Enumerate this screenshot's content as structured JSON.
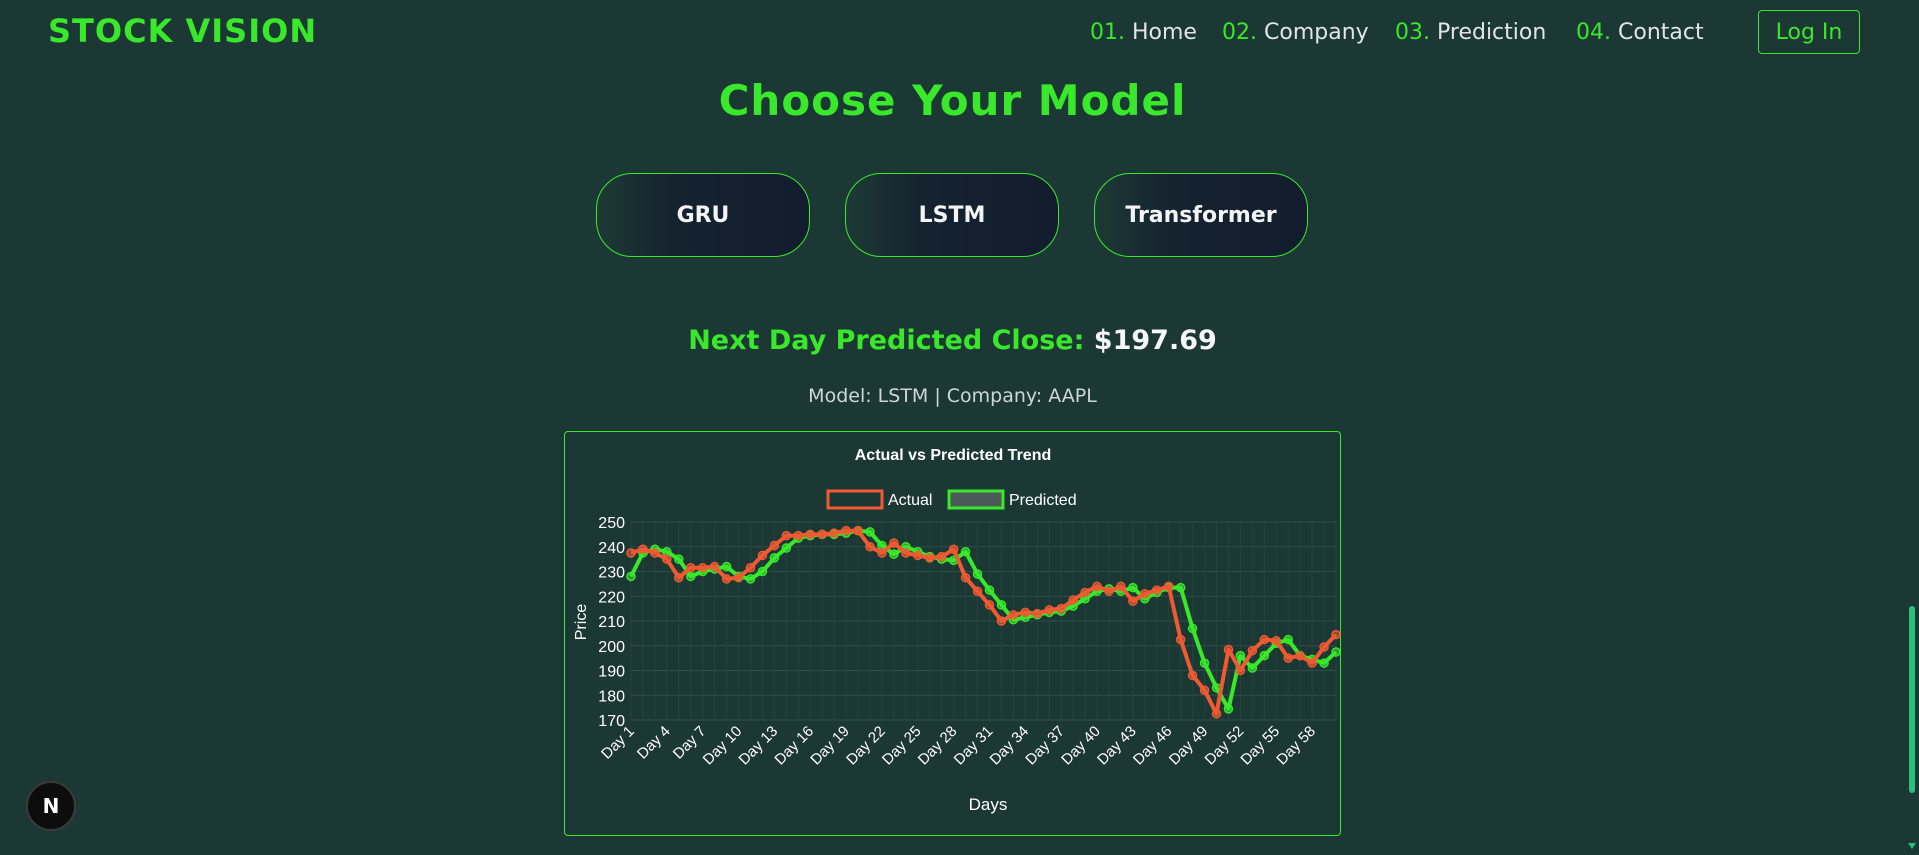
{
  "brand": "STOCK VISION",
  "nav": [
    {
      "num": "01.",
      "label": "Home"
    },
    {
      "num": "02.",
      "label": "Company"
    },
    {
      "num": "03.",
      "label": "Prediction"
    },
    {
      "num": "04.",
      "label": "Contact"
    }
  ],
  "login_label": "Log In",
  "heading": "Choose Your Model",
  "models": [
    "GRU",
    "LSTM",
    "Transformer"
  ],
  "prediction": {
    "label": "Next Day Predicted Close:",
    "value": "$197.69"
  },
  "meta": "Model: LSTM | Company: AAPL",
  "badge_letter": "N",
  "colors": {
    "accent": "#39e82a",
    "actual": "#ef5a32",
    "predicted": "#39e82a",
    "background": "#1c3834"
  },
  "chart_data": {
    "type": "line",
    "title": "Actual vs Predicted Trend",
    "xlabel": "Days",
    "ylabel": "Price",
    "ylim": [
      170,
      250
    ],
    "yticks": [
      170,
      180,
      190,
      200,
      210,
      220,
      230,
      240,
      250
    ],
    "xtick_labels": [
      "Day 1",
      "Day 4",
      "Day 7",
      "Day 10",
      "Day 13",
      "Day 16",
      "Day 19",
      "Day 22",
      "Day 25",
      "Day 28",
      "Day 31",
      "Day 34",
      "Day 37",
      "Day 40",
      "Day 43",
      "Day 46",
      "Day 49",
      "Day 52",
      "Day 55",
      "Day 58"
    ],
    "grid": true,
    "legend_position": "top-center",
    "categories": [
      "Day 1",
      "Day 2",
      "Day 3",
      "Day 4",
      "Day 5",
      "Day 6",
      "Day 7",
      "Day 8",
      "Day 9",
      "Day 10",
      "Day 11",
      "Day 12",
      "Day 13",
      "Day 14",
      "Day 15",
      "Day 16",
      "Day 17",
      "Day 18",
      "Day 19",
      "Day 20",
      "Day 21",
      "Day 22",
      "Day 23",
      "Day 24",
      "Day 25",
      "Day 26",
      "Day 27",
      "Day 28",
      "Day 29",
      "Day 30",
      "Day 31",
      "Day 32",
      "Day 33",
      "Day 34",
      "Day 35",
      "Day 36",
      "Day 37",
      "Day 38",
      "Day 39",
      "Day 40",
      "Day 41",
      "Day 42",
      "Day 43",
      "Day 44",
      "Day 45",
      "Day 46",
      "Day 47",
      "Day 48",
      "Day 49",
      "Day 50",
      "Day 51",
      "Day 52",
      "Day 53",
      "Day 54",
      "Day 55",
      "Day 56",
      "Day 57",
      "Day 58",
      "Day 59",
      "Day 60"
    ],
    "series": [
      {
        "name": "Actual",
        "color": "#ef5a32",
        "values": [
          237.5,
          239,
          237.5,
          235,
          227.5,
          231.5,
          231.5,
          232,
          227,
          227.5,
          231.5,
          236.5,
          240.5,
          244.5,
          244.5,
          245,
          245,
          245.5,
          246.5,
          246.5,
          240,
          237.5,
          241.5,
          237.5,
          236.5,
          235.5,
          236,
          239,
          227.5,
          222,
          216.5,
          210,
          212.5,
          213.5,
          213,
          214.5,
          215,
          218.5,
          221.5,
          224,
          222,
          224,
          218,
          221,
          222.5,
          224,
          202.5,
          188,
          182,
          172.5,
          198.5,
          190,
          198,
          202.5,
          202,
          195,
          196,
          193,
          199.5,
          204.5
        ]
      },
      {
        "name": "Predicted",
        "color": "#39e82a",
        "values": [
          228,
          237.5,
          239,
          238,
          235,
          228,
          230,
          231,
          232,
          228,
          227,
          230,
          235.5,
          239.5,
          243.5,
          244.5,
          245,
          245,
          245.5,
          246.5,
          246,
          240.5,
          237,
          240,
          238,
          236,
          235,
          234.5,
          238,
          229,
          222.5,
          216.5,
          210.5,
          211.5,
          212.5,
          213.5,
          214,
          216,
          219,
          222,
          223,
          222,
          223.5,
          219,
          221.5,
          223.5,
          223.5,
          207,
          193,
          183,
          174.5,
          196,
          191,
          196,
          201,
          202.5,
          196,
          194.5,
          193,
          197.5
        ]
      }
    ]
  }
}
